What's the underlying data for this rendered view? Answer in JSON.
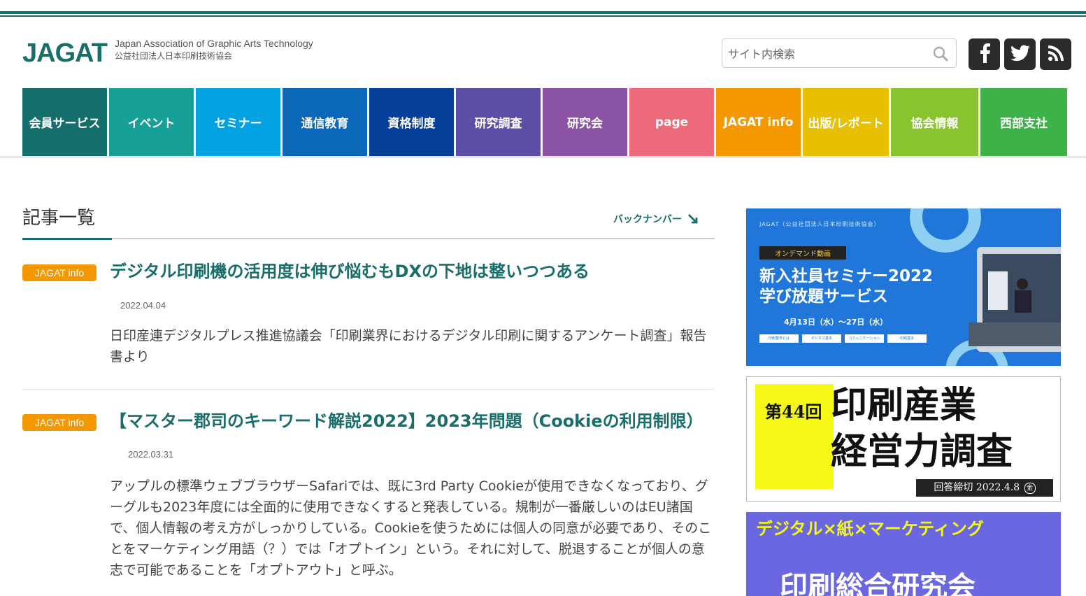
{
  "header": {
    "logo": "JAGAT",
    "subtitle_en": "Japan Association of Graphic Arts Technology",
    "subtitle_ja": "公益社団法人日本印刷技術協会",
    "search_placeholder": "サイト内検索",
    "icons": [
      "search-icon",
      "facebook-icon",
      "twitter-icon",
      "rss-icon"
    ]
  },
  "nav": {
    "items": [
      {
        "label": "会員サービス",
        "color": "#146e6c"
      },
      {
        "label": "イベント",
        "color": "#17a097"
      },
      {
        "label": "セミナー",
        "color": "#03a3e3"
      },
      {
        "label": "通信教育",
        "color": "#0a67b9"
      },
      {
        "label": "資格制度",
        "color": "#063f9a"
      },
      {
        "label": "研究調査",
        "color": "#5b4ea4"
      },
      {
        "label": "研究会",
        "color": "#8a53a4"
      },
      {
        "label": "page",
        "color": "#ec6a7a"
      },
      {
        "label": "JAGAT info",
        "color": "#f39800"
      },
      {
        "label": "出版/レポート",
        "color": "#e8c000"
      },
      {
        "label": "協会情報",
        "color": "#89c430"
      },
      {
        "label": "西部支社",
        "color": "#3db248"
      }
    ]
  },
  "main": {
    "section_title": "記事一覧",
    "back_number": "バックナンバー",
    "articles": [
      {
        "badge": "JAGAT info",
        "title": "デジタル印刷機の活用度は伸び悩むもDXの下地は整いつつある",
        "date": "2022.04.04",
        "summary": "日印産連デジタルプレス推進協議会「印刷業界におけるデジタル印刷に関するアンケート調査」報告書より"
      },
      {
        "badge": "JAGAT info",
        "title": "【マスター郡司のキーワード解説2022】2023年問題（Cookieの利用制限）",
        "date": "2022.03.31",
        "summary": "アップルの標準ウェブブラウザーSafariでは、既に3rd Party Cookieが使用できなくなっており、グーグルも2023年度には全面的に使用できなくすると発表している。規制が一番厳しいのはEU諸国で、個人情報の考え方がしっかりしている。Cookieを使うためには個人の同意が必要であり、そのことをマーケティング用語（？）では「オプトイン」という。それに対して、脱退することが個人の意志で可能であることを「オプトアウト」と呼ぶ。"
      }
    ]
  },
  "sidebar": {
    "banner1": {
      "org": "JAGAT（公益社団法人日本印刷技術協会）",
      "tag": "オンデマンド動画",
      "title1": "新入社員セミナー2022",
      "title2": "学び放題サービス",
      "dates": "4月13日（水）～27日（水）",
      "pills": [
        "印刷業界とは",
        "ビジネス基本",
        "コミュニケーション",
        "印刷基本"
      ]
    },
    "banner2": {
      "prefix": "第44回",
      "line1": "印刷産業",
      "line2": "経営力調査",
      "deadline": "回答締切 2022.4.8",
      "weekday": "金"
    },
    "banner3": {
      "line1": "デジタル×紙×マーケティング",
      "line2": "印刷総合研究会"
    }
  }
}
